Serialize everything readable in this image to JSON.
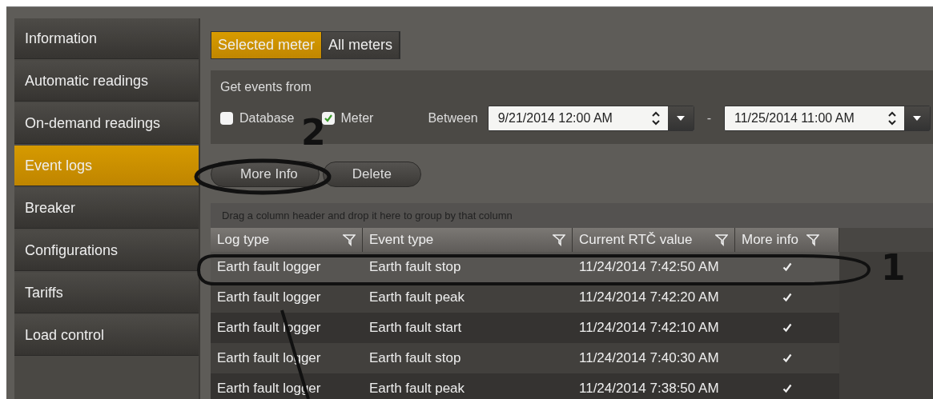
{
  "sidebar": {
    "items": [
      {
        "label": "Information",
        "selected": false
      },
      {
        "label": "Automatic readings",
        "selected": false
      },
      {
        "label": "On-demand readings",
        "selected": false
      },
      {
        "label": "Event logs",
        "selected": true
      },
      {
        "label": "Breaker",
        "selected": false
      },
      {
        "label": "Configurations",
        "selected": false
      },
      {
        "label": "Tariffs",
        "selected": false
      },
      {
        "label": "Load control",
        "selected": false
      }
    ]
  },
  "tabs": [
    {
      "label": "Selected meter",
      "selected": true
    },
    {
      "label": "All meters",
      "selected": false
    }
  ],
  "events_from": {
    "title": "Get events from",
    "sources": [
      {
        "label": "Database",
        "checked": false
      },
      {
        "label": "Meter",
        "checked": true
      }
    ],
    "between_label": "Between",
    "from": "9/21/2014 12:00 AM",
    "separator": "-",
    "to": "11/25/2014 11:00 AM"
  },
  "buttons": [
    "More Info",
    "Delete"
  ],
  "table": {
    "group_hint": "Drag a column header and drop it here to group by that column",
    "columns": [
      "Log type",
      "Event type",
      "Current RTČ value",
      "More info"
    ],
    "rows": [
      {
        "selected": true,
        "log_type": "Earth fault logger",
        "event_type": "Earth fault stop",
        "rtc": "11/24/2014 7:42:50 AM",
        "more_info": true
      },
      {
        "selected": false,
        "log_type": "Earth fault logger",
        "event_type": "Earth fault peak",
        "rtc": "11/24/2014 7:42:20 AM",
        "more_info": true
      },
      {
        "selected": false,
        "log_type": "Earth fault logger",
        "event_type": "Earth fault start",
        "rtc": "11/24/2014 7:42:10 AM",
        "more_info": true
      },
      {
        "selected": false,
        "log_type": "Earth fault logger",
        "event_type": "Earth fault stop",
        "rtc": "11/24/2014 7:40:30 AM",
        "more_info": true
      },
      {
        "selected": false,
        "log_type": "Earth fault logger",
        "event_type": "Earth fault peak",
        "rtc": "11/24/2014 7:38:50 AM",
        "more_info": true
      }
    ]
  },
  "annotations": [
    "1",
    "2"
  ]
}
